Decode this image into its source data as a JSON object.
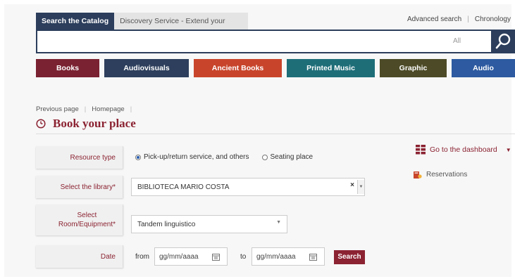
{
  "tabs": {
    "active": "Search the Catalog",
    "inactive": "Discovery Service - Extend your search"
  },
  "top_links": {
    "advanced": "Advanced search",
    "chronology": "Chronology"
  },
  "search": {
    "value": "",
    "placeholder": "",
    "scope": "All"
  },
  "categories": [
    {
      "label": "Books",
      "color": "#7a2232"
    },
    {
      "label": "Audiovisuals",
      "color": "#2d3f5c"
    },
    {
      "label": "Ancient Books",
      "color": "#c8452b"
    },
    {
      "label": "Printed Music",
      "color": "#1e6e78"
    },
    {
      "label": "Graphic",
      "color": "#4d4b27"
    },
    {
      "label": "Audio",
      "color": "#2d5aa0"
    }
  ],
  "breadcrumb": {
    "previous": "Previous page",
    "home": "Homepage"
  },
  "page_title": "Book your place",
  "form": {
    "resource_type": {
      "label": "Resource type",
      "options": [
        "Pick-up/return service, and others",
        "Seating place"
      ],
      "selected": 0
    },
    "library": {
      "label": "Select the library*",
      "value": "BIBLIOTECA MARIO COSTA"
    },
    "room": {
      "label_line1": "Select",
      "label_line2": "Room/Equipment*",
      "value": "Tandem linguistico"
    },
    "date": {
      "label": "Date",
      "from_label": "from",
      "from_placeholder": "gg/mm/aaaa",
      "to_label": "to",
      "to_placeholder": "gg/mm/aaaa",
      "search_label": "Search"
    }
  },
  "side": {
    "dashboard": "Go to the dashboard",
    "reservations": "Reservations"
  },
  "colors": {
    "accent": "#8b2332",
    "navy": "#2c3e5c"
  }
}
